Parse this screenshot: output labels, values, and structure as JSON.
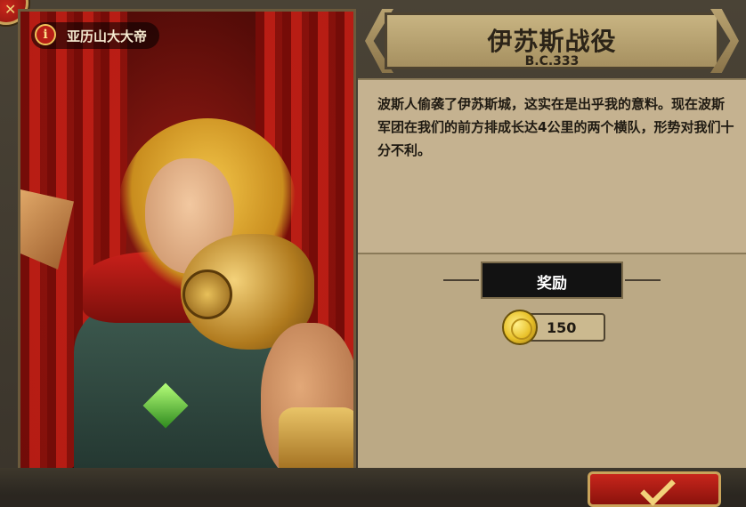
{
  "hero": {
    "name": "亚历山大大帝",
    "info_icon_glyph": "i"
  },
  "battle": {
    "title": "伊苏斯战役",
    "date": "B.C.333",
    "description": "波斯人偷袭了伊苏斯城，这实在是出乎我的意料。现在波斯军团在我们的前方排成长达4公里的两个横队，形势对我们十分不利。"
  },
  "reward": {
    "label": "奖励",
    "coins": "150",
    "coin_icon": "gold-coin-icon"
  },
  "buttons": {
    "close_icon": "close-icon",
    "confirm_icon": "check-icon"
  },
  "colors": {
    "parchment": "#c5b290",
    "banner": "#c8b482",
    "button_red": "#c8261c",
    "gold": "#f2d27a"
  }
}
